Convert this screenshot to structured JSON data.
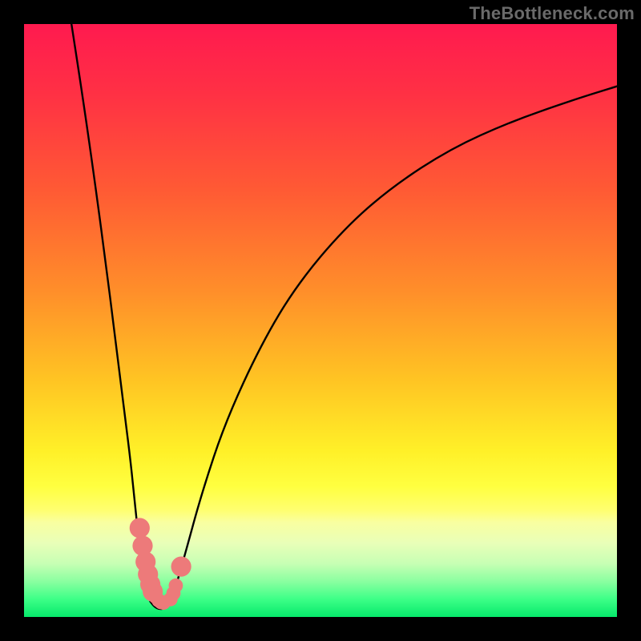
{
  "attribution": "TheBottleneck.com",
  "colors": {
    "background_black": "#000000",
    "curve_stroke": "#000000",
    "dot_fill": "#ed7a7a",
    "gradient_stops": [
      {
        "offset": 0.0,
        "color": "#ff1a4f"
      },
      {
        "offset": 0.12,
        "color": "#ff3144"
      },
      {
        "offset": 0.28,
        "color": "#ff5a34"
      },
      {
        "offset": 0.45,
        "color": "#ff8e2a"
      },
      {
        "offset": 0.6,
        "color": "#ffc423"
      },
      {
        "offset": 0.72,
        "color": "#fff028"
      },
      {
        "offset": 0.78,
        "color": "#ffff40"
      },
      {
        "offset": 0.82,
        "color": "#ffff70"
      },
      {
        "offset": 0.84,
        "color": "#f9ffa0"
      },
      {
        "offset": 0.875,
        "color": "#e9ffb8"
      },
      {
        "offset": 0.91,
        "color": "#c7ffb4"
      },
      {
        "offset": 0.94,
        "color": "#8affa0"
      },
      {
        "offset": 0.97,
        "color": "#3dff87"
      },
      {
        "offset": 1.0,
        "color": "#06e96b"
      }
    ]
  },
  "chart_data": {
    "type": "line",
    "title": "",
    "xlabel": "",
    "ylabel": "",
    "xlim": [
      0,
      100
    ],
    "ylim": [
      0,
      100
    ],
    "series": [
      {
        "name": "left-branch",
        "x": [
          8,
          10,
          12,
          14,
          15,
          16,
          17,
          18,
          18.7,
          19.3,
          19.8,
          20.3,
          20.8,
          21.3
        ],
        "y": [
          100,
          87,
          73,
          58,
          50,
          42,
          34,
          26,
          19,
          13.5,
          9.5,
          6.5,
          4.2,
          2.6
        ]
      },
      {
        "name": "valley-floor",
        "x": [
          21.3,
          22.0,
          22.8,
          23.6,
          24.4,
          25.0
        ],
        "y": [
          2.6,
          1.7,
          1.3,
          1.4,
          2.0,
          3.1
        ]
      },
      {
        "name": "right-branch",
        "x": [
          25.0,
          27,
          30,
          34,
          40,
          46,
          54,
          62,
          72,
          82,
          92,
          100
        ],
        "y": [
          3.1,
          10,
          21,
          33,
          46,
          56,
          65.5,
          72.5,
          79,
          83.5,
          87,
          89.5
        ]
      }
    ],
    "scatter_points": {
      "name": "highlight-dots",
      "x": [
        19.5,
        20.0,
        20.5,
        20.9,
        21.3,
        21.7,
        22.2,
        22.7,
        23.1,
        23.5,
        24.7,
        25.2,
        25.6,
        26.5
      ],
      "y": [
        15.0,
        12.0,
        9.3,
        7.2,
        5.5,
        4.3,
        3.4,
        2.8,
        2.5,
        2.4,
        3.0,
        4.0,
        5.3,
        8.5
      ],
      "r_small": 1.2,
      "r_large": 1.7,
      "large_indices": [
        0,
        1,
        2,
        3,
        4,
        5,
        13
      ]
    }
  }
}
